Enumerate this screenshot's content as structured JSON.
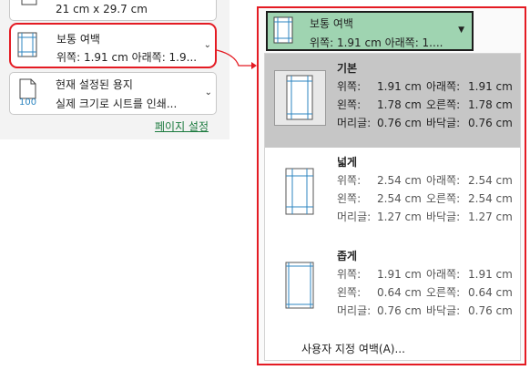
{
  "left": {
    "size_option": {
      "size": "21 cm x 29.7 cm"
    },
    "margin_option": {
      "title": "보통 여백",
      "detail": "위쪽: 1.91 cm 아래쪽: 1.9..."
    },
    "scale_option": {
      "title": "현재 설정된 용지",
      "detail": "실제 크기로 시트를 인쇄...",
      "icon_text": "100"
    },
    "page_setup_link": "페이지 설정"
  },
  "dropdown": {
    "header": {
      "title": "보통 여백",
      "detail": "위쪽: 1.91 cm 아래쪽: 1...."
    },
    "presets": [
      {
        "name": "기본",
        "selected": true,
        "rows": [
          {
            "l1": "위쪽:",
            "v1": "1.91 cm",
            "l2": "아래쪽:",
            "v2": "1.91 cm"
          },
          {
            "l1": "왼쪽:",
            "v1": "1.78 cm",
            "l2": "오른쪽:",
            "v2": "1.78 cm"
          },
          {
            "l1": "머리글:",
            "v1": "0.76 cm",
            "l2": "바닥글:",
            "v2": "0.76 cm"
          }
        ]
      },
      {
        "name": "넓게",
        "selected": false,
        "rows": [
          {
            "l1": "위쪽:",
            "v1": "2.54 cm",
            "l2": "아래쪽:",
            "v2": "2.54 cm"
          },
          {
            "l1": "왼쪽:",
            "v1": "2.54 cm",
            "l2": "오른쪽:",
            "v2": "2.54 cm"
          },
          {
            "l1": "머리글:",
            "v1": "1.27 cm",
            "l2": "바닥글:",
            "v2": "1.27 cm"
          }
        ]
      },
      {
        "name": "좁게",
        "selected": false,
        "rows": [
          {
            "l1": "위쪽:",
            "v1": "1.91 cm",
            "l2": "아래쪽:",
            "v2": "1.91 cm"
          },
          {
            "l1": "왼쪽:",
            "v1": "0.64 cm",
            "l2": "오른쪽:",
            "v2": "0.64 cm"
          },
          {
            "l1": "머리글:",
            "v1": "0.76 cm",
            "l2": "바닥글:",
            "v2": "0.76 cm"
          }
        ]
      }
    ],
    "custom_margins": "사용자 지정 여백(A)..."
  },
  "colors": {
    "highlight_red": "#e41b23",
    "header_green": "#9fd4b1",
    "selected_gray": "#c6c6c6",
    "link_green": "#1b7a3e"
  }
}
